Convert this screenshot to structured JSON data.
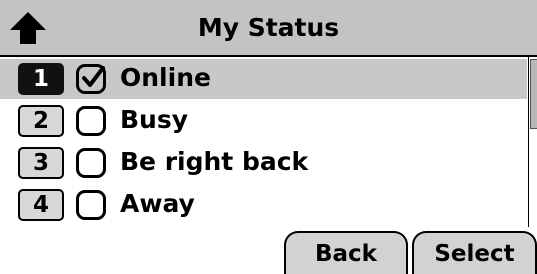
{
  "header": {
    "title": "My Status",
    "nav_icon": "up-arrow-home-icon"
  },
  "status_list": {
    "items": [
      {
        "key": "1",
        "label": "Online",
        "checked": true,
        "selected": true
      },
      {
        "key": "2",
        "label": "Busy",
        "checked": false,
        "selected": false
      },
      {
        "key": "3",
        "label": "Be right back",
        "checked": false,
        "selected": false
      },
      {
        "key": "4",
        "label": "Away",
        "checked": false,
        "selected": false
      }
    ]
  },
  "softkeys": {
    "back_label": "Back",
    "select_label": "Select"
  },
  "colors": {
    "titlebar": "#c3c3c3",
    "selected_row": "#c8c8c8",
    "softkey": "#d2d2d2"
  }
}
